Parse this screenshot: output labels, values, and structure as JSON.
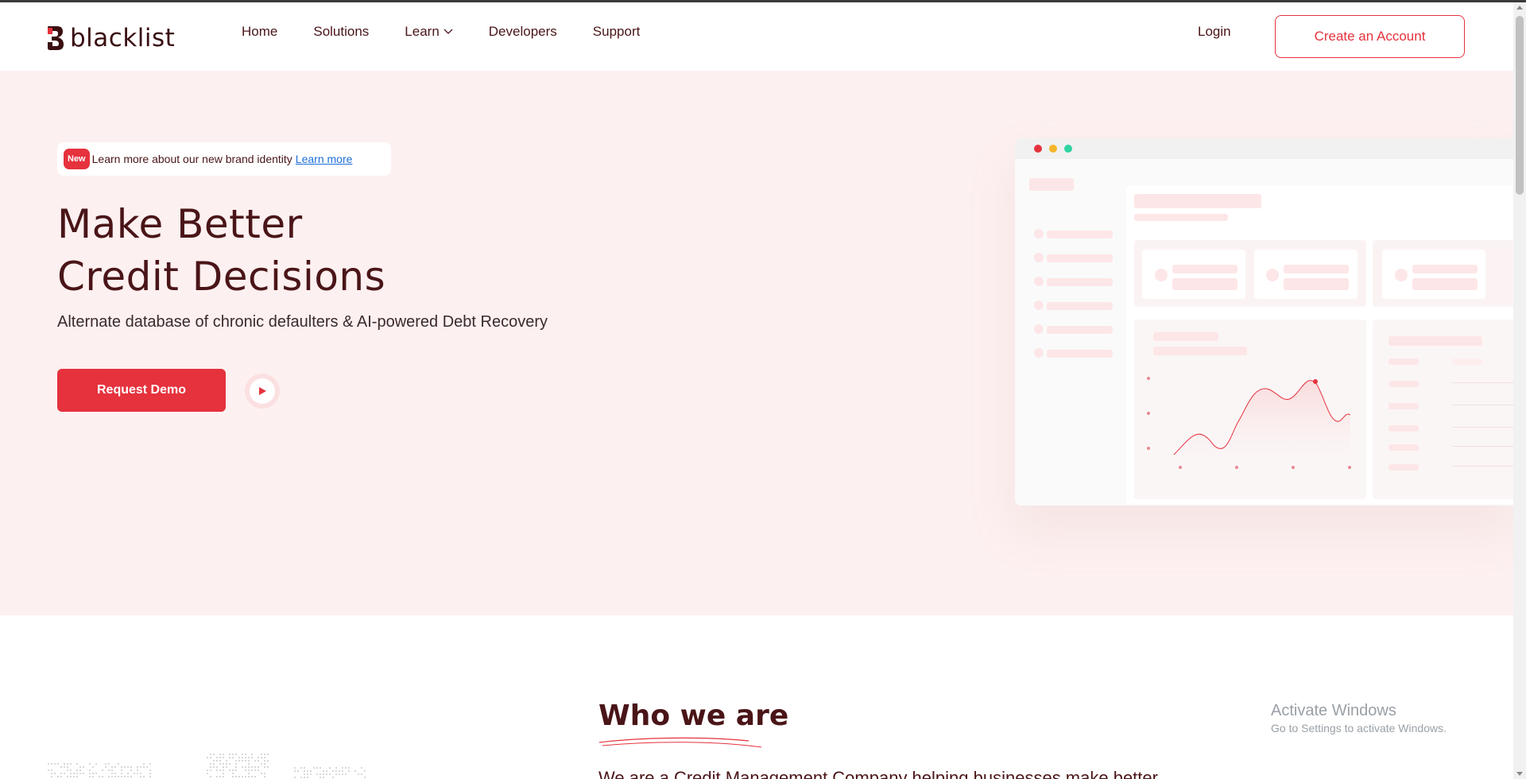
{
  "header": {
    "logo_text": "blacklist",
    "nav": [
      {
        "label": "Home"
      },
      {
        "label": "Solutions"
      },
      {
        "label": "Learn"
      },
      {
        "label": "Developers"
      },
      {
        "label": "Support"
      }
    ],
    "login_label": "Login",
    "create_account_label": "Create an Account"
  },
  "hero": {
    "badge_new": "New",
    "badge_text": "Learn more about our new brand identity",
    "badge_link": "Learn more",
    "title_line1": "Make Better",
    "title_line2": "Credit Decisions",
    "subtitle": "Alternate database of chronic defaulters & AI-powered Debt Recovery",
    "demo_button": "Request Demo",
    "play_icon": "play-icon"
  },
  "who": {
    "title": "Who we are",
    "text": "We are a Credit Management Company helping businesses make better"
  },
  "os_overlay": {
    "title": "Activate Windows",
    "subtitle": "Go to Settings to activate Windows."
  },
  "colors": {
    "accent": "#e5323d",
    "hero_bg": "#fdf0f0",
    "text_dark": "#4a1518",
    "link": "#1e6fd9"
  }
}
